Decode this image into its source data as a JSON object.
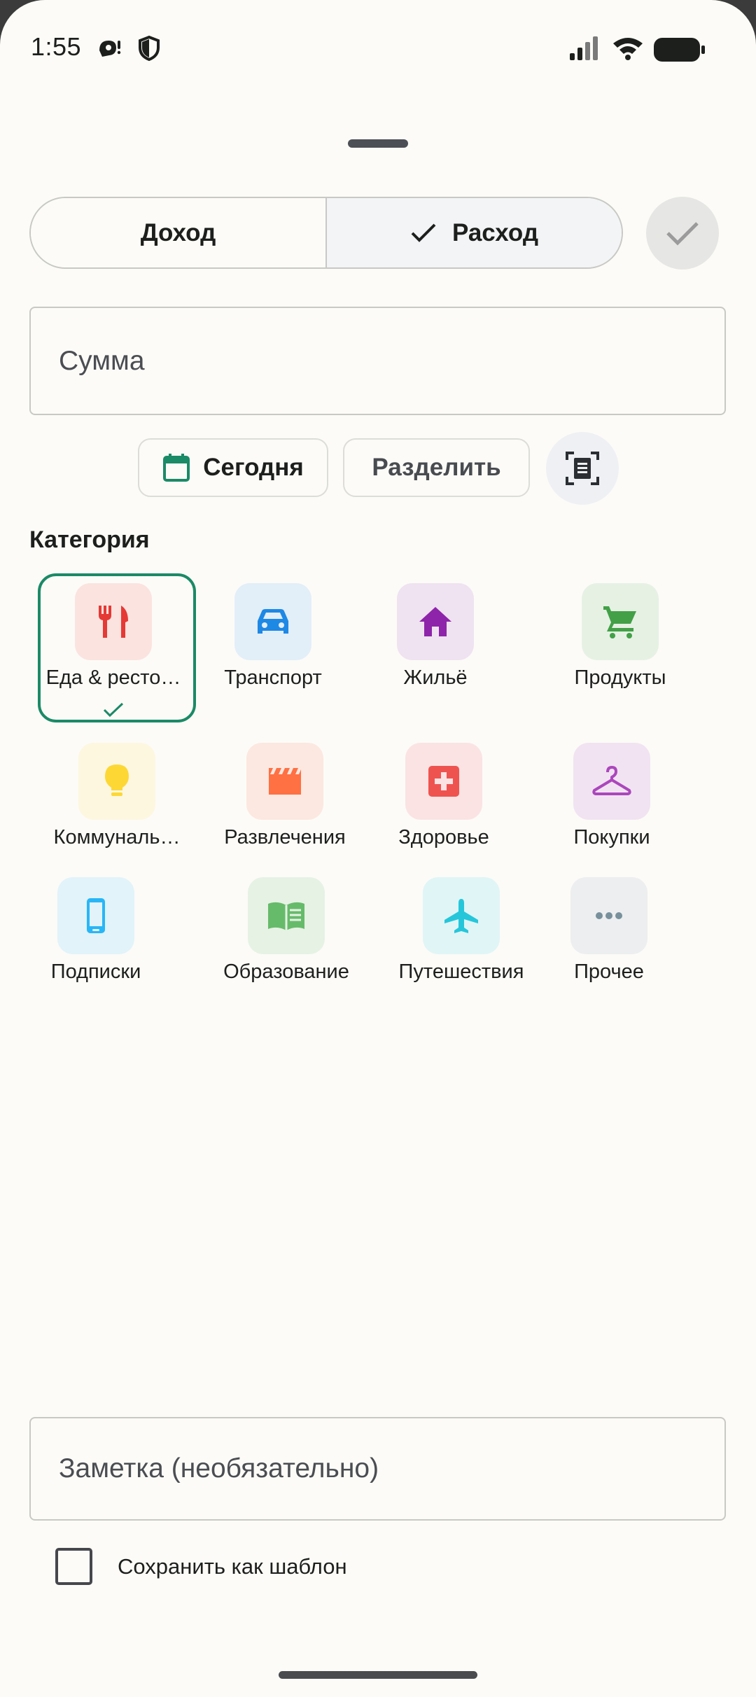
{
  "status": {
    "time": "1:55"
  },
  "type_toggle": {
    "income_label": "Доход",
    "expense_label": "Расход",
    "selected": "expense"
  },
  "amount": {
    "placeholder": "Сумма",
    "value": ""
  },
  "date_chip": {
    "label": "Сегодня"
  },
  "split_chip": {
    "label": "Разделить"
  },
  "category": {
    "heading": "Категория",
    "selected": "food",
    "items": [
      {
        "id": "food",
        "label": "Еда & ресто…",
        "icon": "fork-knife-icon",
        "color": "#e53935",
        "bg": "#fbe3df"
      },
      {
        "id": "transport",
        "label": "Транспорт",
        "icon": "car-icon",
        "color": "#1e88e5",
        "bg": "#e2eef8"
      },
      {
        "id": "housing",
        "label": "Жильё",
        "icon": "home-icon",
        "color": "#8e24aa",
        "bg": "#efe2f1"
      },
      {
        "id": "groceries",
        "label": "Продукты",
        "icon": "cart-icon",
        "color": "#43a047",
        "bg": "#e6f1e4"
      },
      {
        "id": "utilities",
        "label": "Коммуналь…",
        "icon": "lightbulb-icon",
        "color": "#fdd835",
        "bg": "#fdf7e0"
      },
      {
        "id": "entertainment",
        "label": "Развлечения",
        "icon": "clapperboard-icon",
        "color": "#ff7043",
        "bg": "#fce8e0"
      },
      {
        "id": "health",
        "label": "Здоровье",
        "icon": "medical-icon",
        "color": "#ef5350",
        "bg": "#fbe3e3"
      },
      {
        "id": "shopping",
        "label": "Покупки",
        "icon": "hanger-icon",
        "color": "#ab47bc",
        "bg": "#f1e3f2"
      },
      {
        "id": "subscriptions",
        "label": "Подписки",
        "icon": "phone-icon",
        "color": "#29b6f6",
        "bg": "#e2f3fa"
      },
      {
        "id": "education",
        "label": "Образование",
        "icon": "book-icon",
        "color": "#66bb6a",
        "bg": "#e6f2e4"
      },
      {
        "id": "travel",
        "label": "Путешествия",
        "icon": "airplane-icon",
        "color": "#26c6da",
        "bg": "#e0f5f6"
      },
      {
        "id": "other",
        "label": "Прочее",
        "icon": "more-dots-icon",
        "color": "#78909c",
        "bg": "#eceeef"
      }
    ]
  },
  "note": {
    "placeholder": "Заметка (необязательно)",
    "value": ""
  },
  "template": {
    "label": "Сохранить как шаблон",
    "checked": false
  }
}
